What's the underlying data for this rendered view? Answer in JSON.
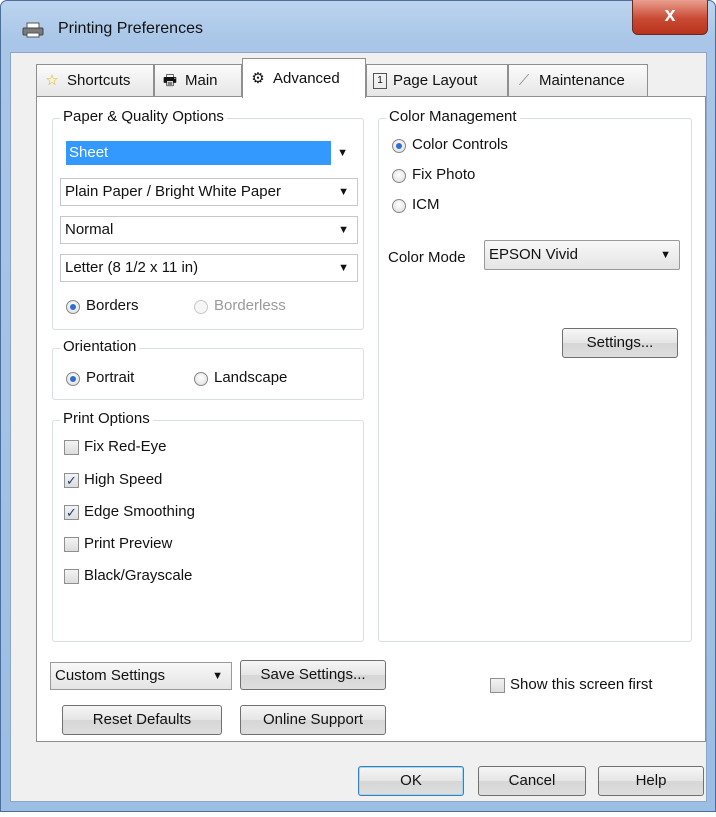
{
  "window": {
    "title": "Printing Preferences",
    "close_label": "x"
  },
  "tabs": [
    {
      "label": "Shortcuts",
      "icon": "star-icon"
    },
    {
      "label": "Main",
      "icon": "printer-icon"
    },
    {
      "label": "Advanced",
      "icon": "gears-icon",
      "active": true
    },
    {
      "label": "Page Layout",
      "icon": "page-icon"
    },
    {
      "label": "Maintenance",
      "icon": "wrench-icon"
    }
  ],
  "paper_quality": {
    "group_label": "Paper & Quality Options",
    "source_value": "Sheet",
    "type_value": "Plain Paper / Bright White Paper",
    "quality_value": "Normal",
    "size_value": "Letter (8 1/2 x 11 in)",
    "borders_label": "Borders",
    "borderless_label": "Borderless"
  },
  "orientation": {
    "group_label": "Orientation",
    "portrait_label": "Portrait",
    "landscape_label": "Landscape"
  },
  "print_options": {
    "group_label": "Print Options",
    "items": [
      {
        "label": "Fix Red-Eye",
        "checked": false
      },
      {
        "label": "High Speed",
        "checked": true
      },
      {
        "label": "Edge Smoothing",
        "checked": true
      },
      {
        "label": "Print Preview",
        "checked": false
      },
      {
        "label": "Black/Grayscale",
        "checked": false
      }
    ]
  },
  "color_management": {
    "group_label": "Color Management",
    "color_controls_label": "Color Controls",
    "fix_photo_label": "Fix Photo",
    "icm_label": "ICM",
    "color_mode_label": "Color Mode",
    "color_mode_value": "EPSON Vivid",
    "settings_button": "Settings..."
  },
  "bottom": {
    "custom_settings_value": "Custom Settings",
    "save_settings_button": "Save Settings...",
    "reset_defaults_button": "Reset Defaults",
    "online_support_button": "Online Support",
    "show_screen_first_label": "Show this screen first"
  },
  "dialog_buttons": {
    "ok": "OK",
    "cancel": "Cancel",
    "help": "Help"
  },
  "colors": {
    "selection": "#3399ff",
    "radio_dot": "#2b6fd6",
    "close_button": "#c94a33"
  }
}
